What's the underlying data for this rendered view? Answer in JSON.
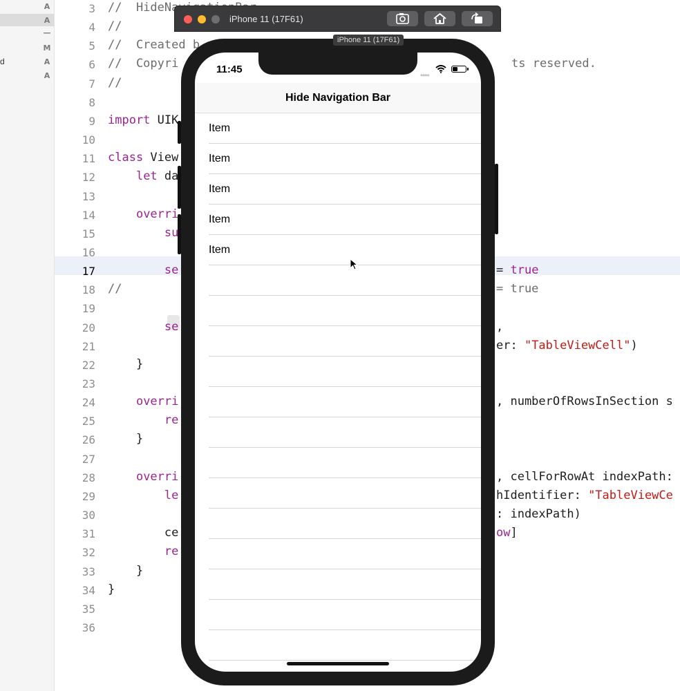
{
  "sidebar": {
    "badges": [
      "A",
      "A",
      "—",
      "M",
      "A",
      "A"
    ],
    "fragment": "d"
  },
  "editor": {
    "current_line": "17",
    "lines": [
      {
        "n": "3",
        "segments": [
          {
            "t": "//  HideNavigationBar",
            "c": "cmt"
          }
        ]
      },
      {
        "n": "4",
        "segments": [
          {
            "t": "//",
            "c": "cmt"
          }
        ]
      },
      {
        "n": "5",
        "segments": [
          {
            "t": "//  Created b",
            "c": "cmt"
          }
        ]
      },
      {
        "n": "6",
        "segments": [
          {
            "t": "//  Copyri",
            "c": "cmt"
          }
        ]
      },
      {
        "n": "7",
        "segments": [
          {
            "t": "//",
            "c": "cmt"
          }
        ]
      },
      {
        "n": "8",
        "segments": []
      },
      {
        "n": "9",
        "segments": [
          {
            "t": "import",
            "c": "kw"
          },
          {
            "t": " UIK",
            "c": ""
          }
        ]
      },
      {
        "n": "10",
        "segments": []
      },
      {
        "n": "11",
        "segments": [
          {
            "t": "class",
            "c": "kw"
          },
          {
            "t": " View",
            "c": ""
          }
        ]
      },
      {
        "n": "12",
        "segments": [
          {
            "t": "    ",
            "c": ""
          },
          {
            "t": "let",
            "c": "kw"
          },
          {
            "t": " da",
            "c": ""
          }
        ]
      },
      {
        "n": "13",
        "segments": []
      },
      {
        "n": "14",
        "segments": [
          {
            "t": "    ",
            "c": ""
          },
          {
            "t": "overri",
            "c": "kw"
          }
        ]
      },
      {
        "n": "15",
        "segments": [
          {
            "t": "        ",
            "c": ""
          },
          {
            "t": "su",
            "c": "kw"
          }
        ]
      },
      {
        "n": "16",
        "segments": []
      },
      {
        "n": "17",
        "segments": [
          {
            "t": "        ",
            "c": ""
          },
          {
            "t": "se",
            "c": "kw"
          }
        ]
      },
      {
        "n": "18",
        "segments": [
          {
            "t": "//",
            "c": "cmt"
          }
        ]
      },
      {
        "n": "19",
        "segments": []
      },
      {
        "n": "20",
        "segments": [
          {
            "t": "        ",
            "c": ""
          },
          {
            "t": "se",
            "c": "kw"
          }
        ]
      },
      {
        "n": "21",
        "segments": []
      },
      {
        "n": "22",
        "segments": [
          {
            "t": "    }",
            "c": ""
          }
        ]
      },
      {
        "n": "23",
        "segments": []
      },
      {
        "n": "24",
        "segments": [
          {
            "t": "    ",
            "c": ""
          },
          {
            "t": "overri",
            "c": "kw"
          }
        ]
      },
      {
        "n": "25",
        "segments": [
          {
            "t": "        ",
            "c": ""
          },
          {
            "t": "re",
            "c": "kw"
          }
        ]
      },
      {
        "n": "26",
        "segments": [
          {
            "t": "    }",
            "c": ""
          }
        ]
      },
      {
        "n": "27",
        "segments": []
      },
      {
        "n": "28",
        "segments": [
          {
            "t": "    ",
            "c": ""
          },
          {
            "t": "overri",
            "c": "kw"
          }
        ]
      },
      {
        "n": "29",
        "segments": [
          {
            "t": "        ",
            "c": ""
          },
          {
            "t": "le",
            "c": "kw"
          }
        ]
      },
      {
        "n": "30",
        "segments": []
      },
      {
        "n": "31",
        "segments": [
          {
            "t": "        ce",
            "c": ""
          }
        ]
      },
      {
        "n": "32",
        "segments": [
          {
            "t": "        ",
            "c": ""
          },
          {
            "t": "re",
            "c": "kw"
          }
        ]
      },
      {
        "n": "33",
        "segments": [
          {
            "t": "    }",
            "c": ""
          }
        ]
      },
      {
        "n": "34",
        "segments": [
          {
            "t": "}",
            "c": ""
          }
        ]
      },
      {
        "n": "35",
        "segments": []
      },
      {
        "n": "36",
        "segments": []
      }
    ],
    "right_fragments": [
      {
        "n": "6",
        "segments": [
          {
            "t": "ts reserved.",
            "c": "cmt"
          }
        ]
      },
      {
        "n": "17",
        "segments": [
          {
            "t": "= ",
            "c": ""
          },
          {
            "t": "true",
            "c": "kw"
          }
        ]
      },
      {
        "n": "18",
        "segments": [
          {
            "t": "= true",
            "c": "cmt"
          }
        ]
      },
      {
        "n": "20",
        "segments": [
          {
            "t": ",",
            "c": ""
          }
        ]
      },
      {
        "n": "21",
        "segments": [
          {
            "t": "er: ",
            "c": ""
          },
          {
            "t": "\"TableViewCell\"",
            "c": "str"
          },
          {
            "t": ")",
            "c": ""
          }
        ]
      },
      {
        "n": "24",
        "segments": [
          {
            "t": ", numberOfRowsInSection s",
            "c": ""
          }
        ]
      },
      {
        "n": "28",
        "segments": [
          {
            "t": ", cellForRowAt indexPath:",
            "c": ""
          }
        ]
      },
      {
        "n": "29",
        "segments": [
          {
            "t": "hIdentifier: ",
            "c": ""
          },
          {
            "t": "\"TableViewCe",
            "c": "str"
          }
        ]
      },
      {
        "n": "30",
        "segments": [
          {
            "t": ": indexPath)",
            "c": ""
          }
        ]
      },
      {
        "n": "31",
        "segments": [
          {
            "t": "ow",
            "c": "kw"
          },
          {
            "t": "]",
            "c": ""
          }
        ]
      }
    ]
  },
  "simulator": {
    "title": "iPhone 11 (17F61)",
    "tooltip": "iPhone 11 (17F61)",
    "buttons": [
      "screenshot-icon",
      "home-icon",
      "rotate-icon"
    ],
    "colors": {
      "close": "#ff5f57",
      "minimize": "#febc2e",
      "zoom": "#6e6e70"
    }
  },
  "phone": {
    "time": "11:45",
    "nav_title": "Hide Navigation Bar",
    "rows": [
      "Item",
      "Item",
      "Item",
      "Item",
      "Item",
      "",
      "",
      "",
      "",
      "",
      "",
      "",
      "",
      "",
      "",
      "",
      "",
      ""
    ]
  }
}
